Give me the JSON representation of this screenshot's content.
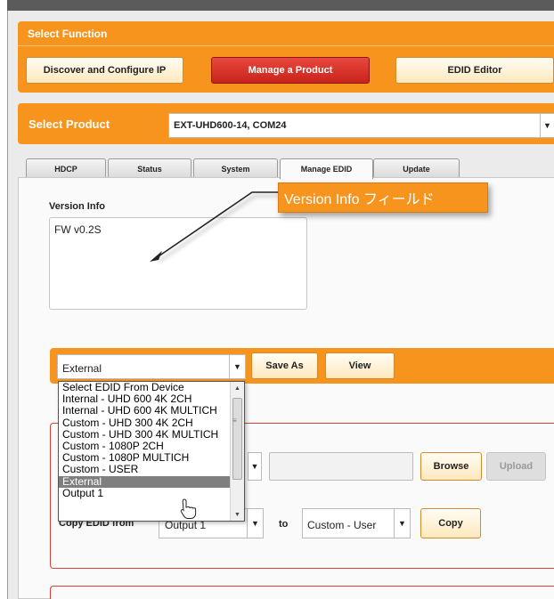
{
  "select_function": {
    "title": "Select Function",
    "buttons": [
      {
        "label": "Discover and Configure IP"
      },
      {
        "label": "Manage a Product"
      },
      {
        "label": "EDID Editor"
      }
    ]
  },
  "select_product": {
    "title": "Select Product",
    "value": "EXT-UHD600-14, COM24"
  },
  "tabs": [
    {
      "label": "HDCP"
    },
    {
      "label": "Status"
    },
    {
      "label": "System"
    },
    {
      "label": "Manage EDID"
    },
    {
      "label": "Update"
    }
  ],
  "active_tab": "Manage EDID",
  "version_info": {
    "label": "Version Info",
    "value": "FW v0.2S"
  },
  "callout": {
    "text": "Version Info フィールド",
    "color": "#f7941d"
  },
  "edid_bar": {
    "selected": "External",
    "save_as_label": "Save As",
    "view_label": "View"
  },
  "edid_dropdown": {
    "options": [
      "Select EDID From Device",
      "Internal - UHD 600 4K 2CH",
      "Internal - UHD 600 4K MULTICH",
      "Custom - UHD 300 4K 2CH",
      "Custom - UHD 300 4K MULTICH",
      "Custom - 1080P 2CH",
      "Custom - 1080P MULTICH",
      "Custom - USER",
      "External",
      "Output 1"
    ],
    "highlighted": "External"
  },
  "upload_section": {
    "browse_label": "Browse",
    "upload_label": "Upload"
  },
  "copy_section": {
    "label": "Copy EDID from",
    "from_value": "Output 1",
    "to_label": "to",
    "to_value": "Custom - User",
    "copy_label": "Copy"
  },
  "colors": {
    "accent_orange": "#f7941d",
    "active_red": "#d42e25",
    "section_border": "#d3423a"
  }
}
